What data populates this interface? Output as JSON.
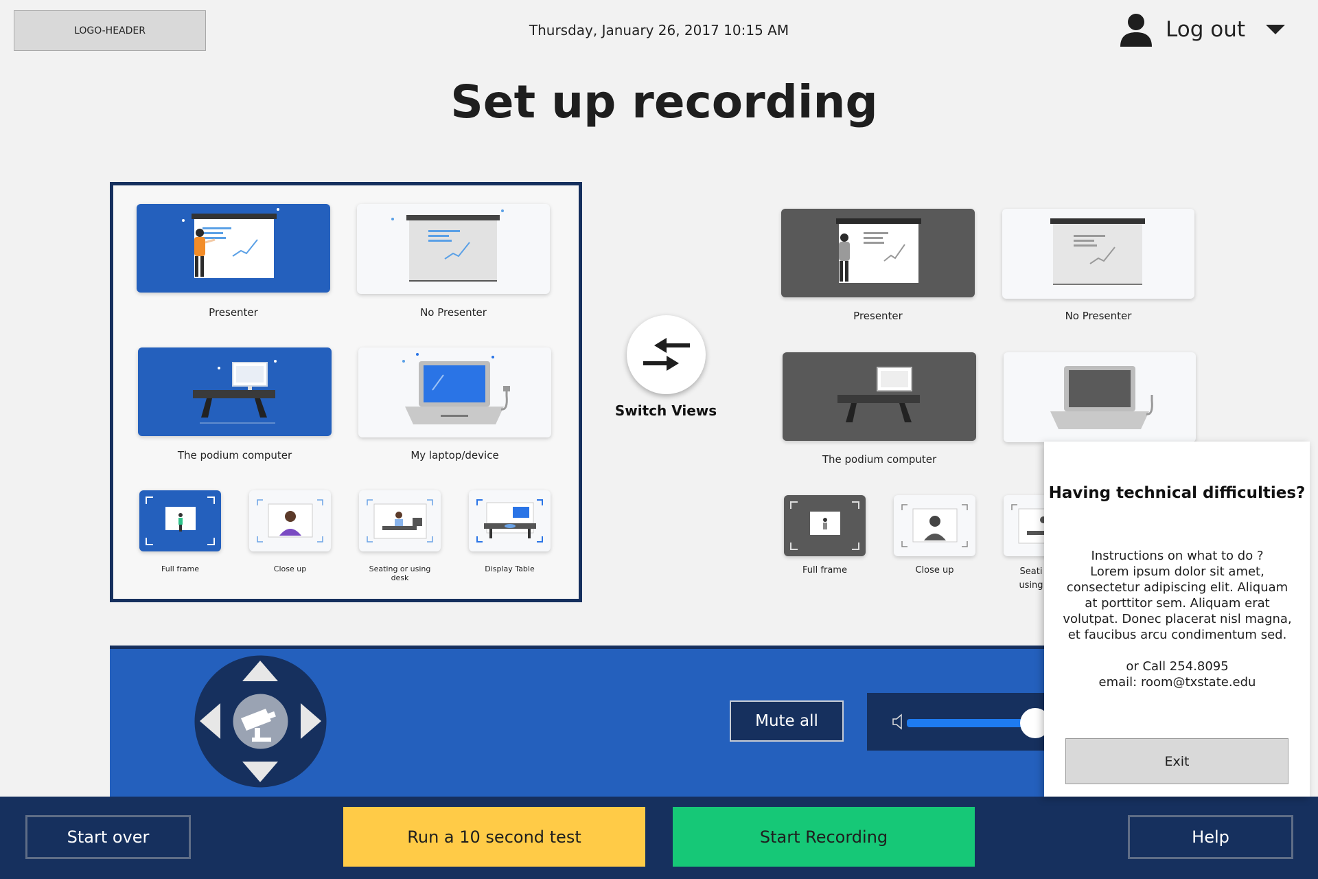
{
  "header": {
    "logo_text": "LOGO-HEADER",
    "datetime": "Thursday, January  26, 2017 10:15 AM",
    "logout_label": "Log out"
  },
  "page_title": "Set up recording",
  "left_sources": {
    "presenter": "Presenter",
    "no_presenter": "No Presenter",
    "podium": "The podium computer",
    "laptop": "My laptop/device",
    "full_frame": "Full frame",
    "close_up": "Close up",
    "seating": "Seating or using desk",
    "display_table": "Display Table"
  },
  "switch_views_label": "Switch Views",
  "right_sources": {
    "presenter": "Presenter",
    "no_presenter": "No Presenter",
    "podium": "The podium computer",
    "full_frame": "Full frame",
    "close_up": "Close up",
    "seating_line1": "Seati",
    "seating_line2": "using"
  },
  "controls": {
    "mute_all": "Mute all",
    "volume_level": 0.85
  },
  "footer": {
    "start_over": "Start over",
    "run_test": "Run a 10 second test",
    "start_recording": "Start Recording",
    "help": "Help"
  },
  "help_popup": {
    "title": "Having technical difficulties?",
    "line1": "Instructions on what to do ?",
    "line2": "Lorem ipsum dolor sit amet,",
    "line3": "consectetur adipiscing elit. Aliquam",
    "line4": "at porttitor sem.  Aliquam erat",
    "line5": "volutpat. Donec placerat nisl magna,",
    "line6": "et faucibus arcu condimentum sed.",
    "phone": "or Call 254.8095",
    "email": "email: room@txstate.edu",
    "exit": "Exit"
  },
  "colors": {
    "selected_blue": "#2460bd",
    "navy": "#16305e",
    "inactive_gray": "#595959",
    "test_yellow": "#ffcb47",
    "record_green": "#16c877"
  },
  "icons": [
    "user-icon",
    "caret-down-icon",
    "swap-arrows-icon",
    "camera-icon",
    "speaker-icon"
  ]
}
